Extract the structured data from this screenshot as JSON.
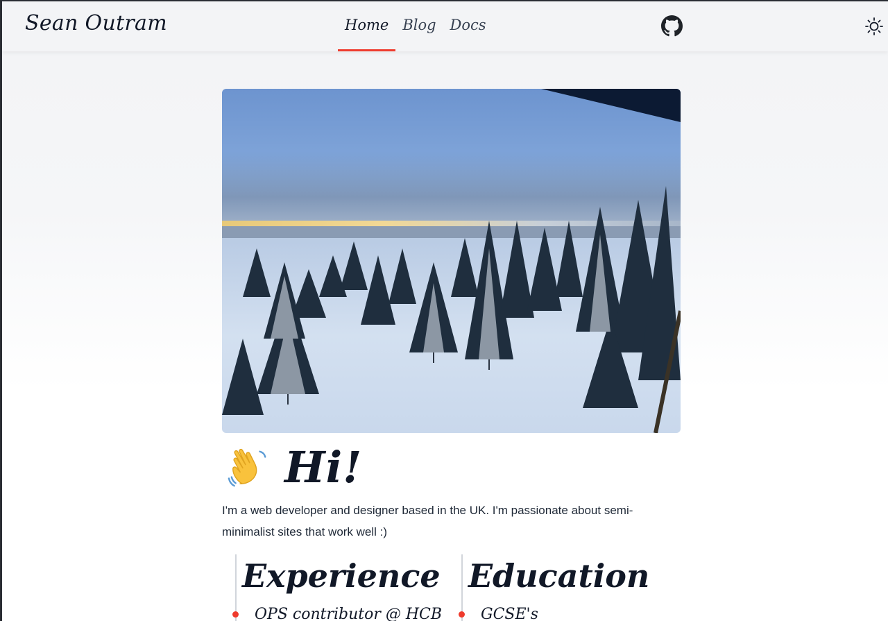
{
  "site": {
    "logo": "Sean Outram"
  },
  "nav": {
    "items": [
      {
        "label": "Home",
        "active": true
      },
      {
        "label": "Blog",
        "active": false
      },
      {
        "label": "Docs",
        "active": false
      }
    ]
  },
  "icons": {
    "github": "github-icon",
    "theme": "sun-icon",
    "greeting": "waving-hand-icon"
  },
  "hero": {
    "alt": "Snowy forest landscape viewed from above"
  },
  "intro": {
    "heading": "Hi!",
    "text": "I'm a web developer and designer based in the UK. I'm passionate about semi-minimalist sites that work well :)"
  },
  "sections": {
    "experience": {
      "title": "Experience",
      "first_item": "OPS contributor @ HCB"
    },
    "education": {
      "title": "Education",
      "first_item": "GCSE's"
    }
  },
  "colors": {
    "accent": "#ef3b2d",
    "header_bg": "#f3f4f6",
    "text": "#111827"
  }
}
